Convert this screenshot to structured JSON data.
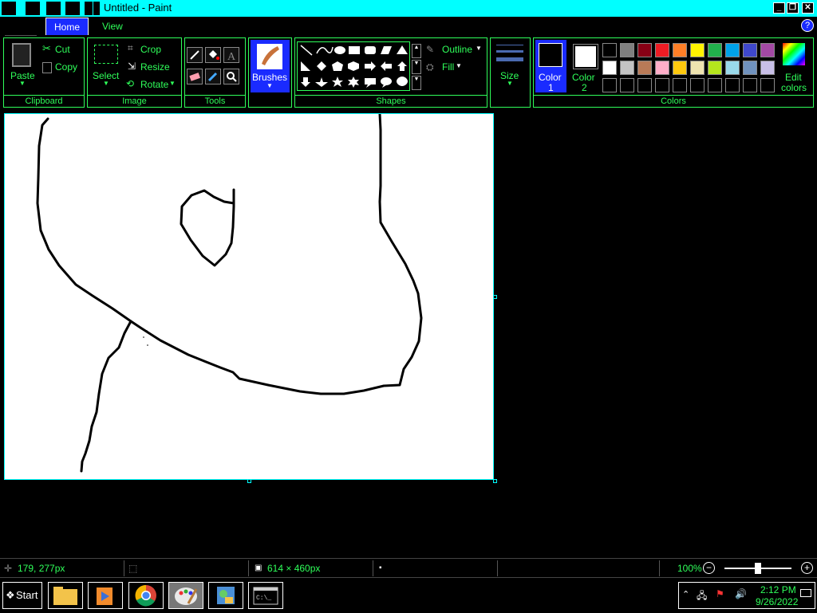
{
  "window": {
    "title": "Untitled - Paint"
  },
  "tabs": {
    "home": "Home",
    "view": "View"
  },
  "clipboard": {
    "paste": "Paste",
    "cut": "Cut",
    "copy": "Copy",
    "group": "Clipboard"
  },
  "image": {
    "select": "Select",
    "crop": "Crop",
    "resize": "Resize",
    "rotate": "Rotate",
    "group": "Image"
  },
  "tools": {
    "group": "Tools"
  },
  "brushes": {
    "label": "Brushes"
  },
  "shapes": {
    "outline": "Outline",
    "fill": "Fill",
    "group": "Shapes"
  },
  "size": {
    "label": "Size"
  },
  "colors": {
    "color1": "Color",
    "color1_num": "1",
    "color2": "Color",
    "color2_num": "2",
    "edit": "Edit",
    "edit2": "colors",
    "group": "Colors",
    "palette_row1": [
      "#000000",
      "#7f7f7f",
      "#880015",
      "#ed1c24",
      "#ff7f27",
      "#fff200",
      "#22b14c",
      "#00a2e8",
      "#3f48cc",
      "#a349a4"
    ],
    "palette_row2": [
      "#ffffff",
      "#c3c3c3",
      "#b97a57",
      "#ffaec9",
      "#ffc90e",
      "#efe4b0",
      "#b5e61d",
      "#99d9ea",
      "#7092be",
      "#c8bfe7"
    ]
  },
  "status": {
    "cursor_pos": "179, 277px",
    "canvas_size": "614 × 460px",
    "zoom": "100%"
  },
  "taskbar": {
    "start": "Start",
    "time": "2:12 PM",
    "date": "9/26/2022"
  }
}
